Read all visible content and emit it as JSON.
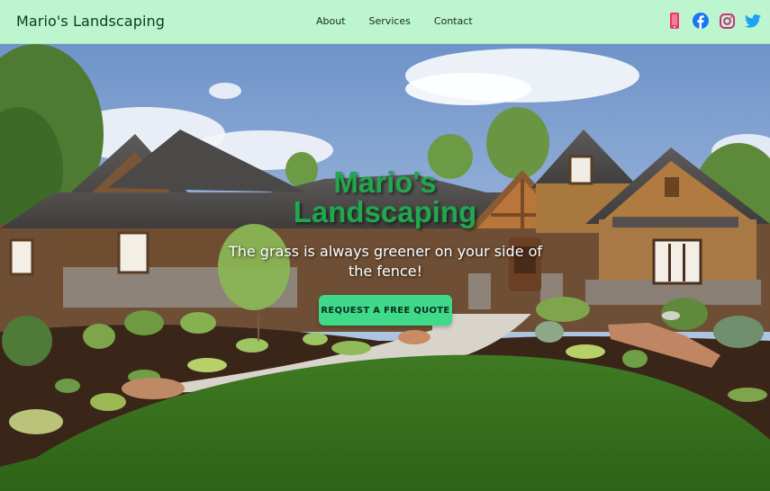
{
  "navbar": {
    "brand": "Mario's Landscaping",
    "links": [
      {
        "label": "About"
      },
      {
        "label": "Services"
      },
      {
        "label": "Contact"
      }
    ],
    "social_icons": [
      "phone-icon",
      "facebook-icon",
      "instagram-icon",
      "twitter-icon"
    ]
  },
  "hero": {
    "title_line1": "Mario's",
    "title_line2": "Landscaping",
    "subtitle": "The grass is always greener on your side of the fence!",
    "cta_label": "REQUEST A FREE QUOTE",
    "background": "house-and-lawn-photo"
  },
  "colors": {
    "navbar_bg": "#bdf5cf",
    "brand_text": "#0d3b22",
    "title_green": "#1fa84d",
    "cta_bg": "#3fd98a",
    "phone_icon": "#e8366d",
    "facebook_icon": "#1877f2",
    "instagram_icon": "#c8327a",
    "twitter_icon": "#1da1f2"
  }
}
